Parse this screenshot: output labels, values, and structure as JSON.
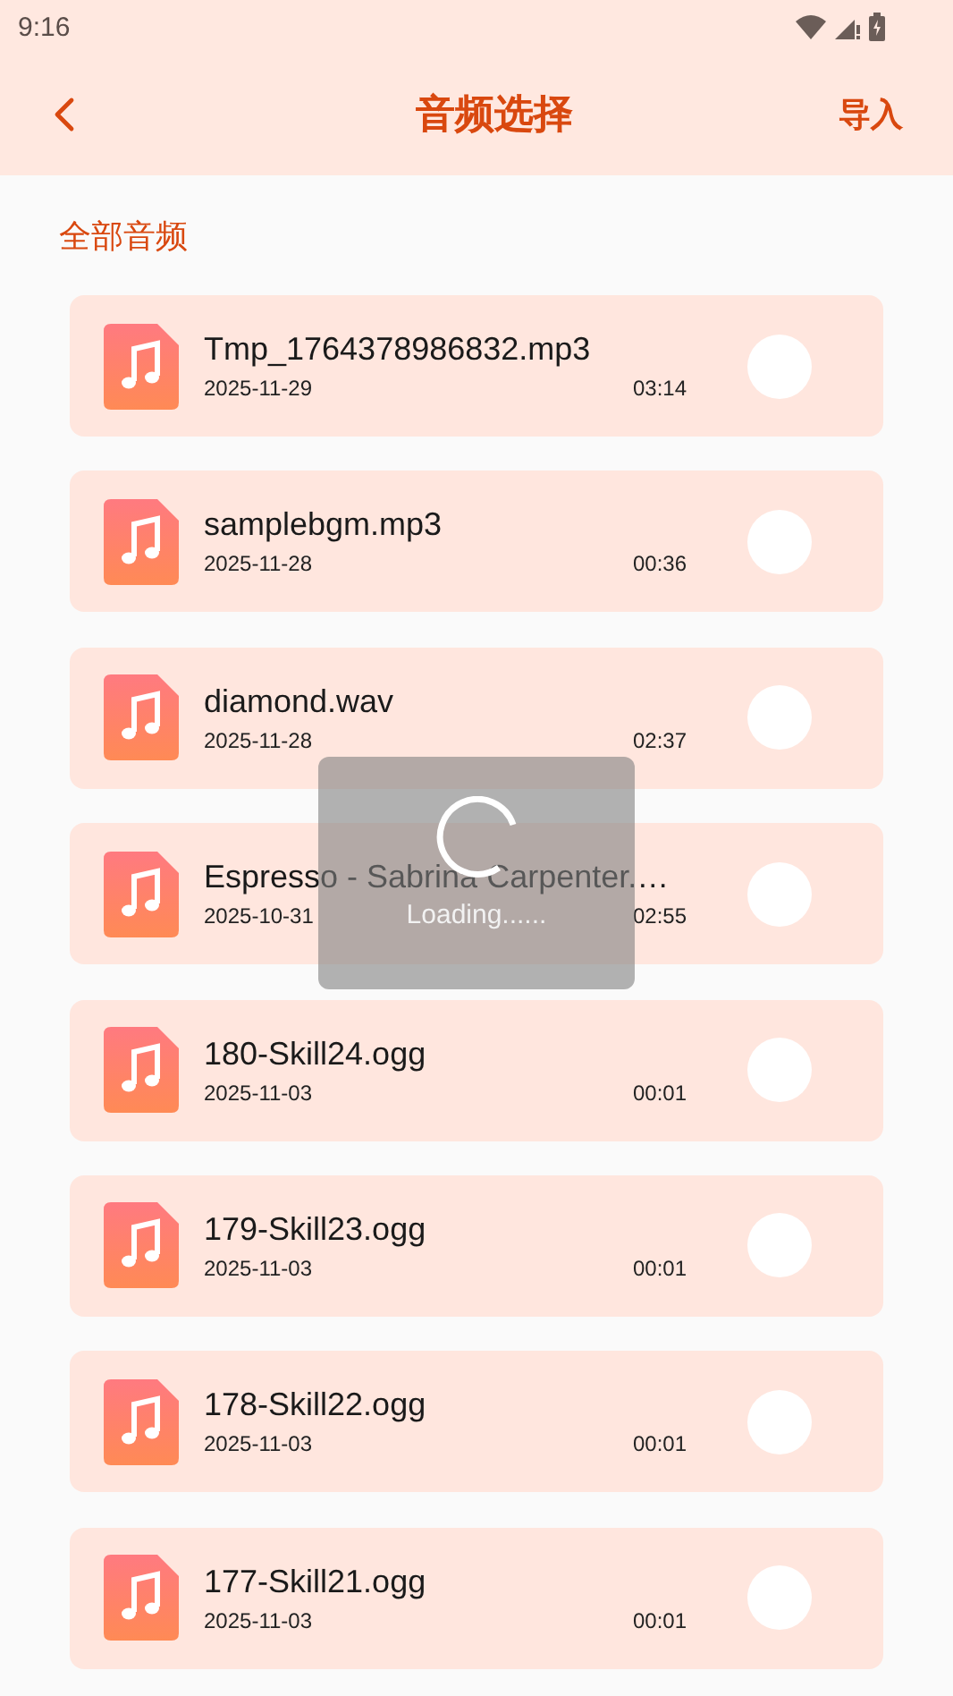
{
  "status_bar": {
    "time": "9:16"
  },
  "header": {
    "title": "音频选择",
    "action": "导入"
  },
  "section_title": "全部音频",
  "files": [
    {
      "name": "Tmp_1764378986832.mp3",
      "date": "2025-11-29",
      "duration": "03:14",
      "selected": false
    },
    {
      "name": "samplebgm.mp3",
      "date": "2025-11-28",
      "duration": "00:36",
      "selected": false
    },
    {
      "name": "diamond.wav",
      "date": "2025-11-28",
      "duration": "02:37",
      "selected": false
    },
    {
      "name": "Espresso - Sabrina Carpenter.…",
      "date": "2025-10-31",
      "duration": "02:55",
      "selected": false
    },
    {
      "name": "180-Skill24.ogg",
      "date": "2025-11-03",
      "duration": "00:01",
      "selected": false
    },
    {
      "name": "179-Skill23.ogg",
      "date": "2025-11-03",
      "duration": "00:01",
      "selected": false
    },
    {
      "name": "178-Skill22.ogg",
      "date": "2025-11-03",
      "duration": "00:01",
      "selected": false
    },
    {
      "name": "177-Skill21.ogg",
      "date": "2025-11-03",
      "duration": "00:01",
      "selected": false
    }
  ],
  "loading": {
    "text": "Loading......"
  }
}
